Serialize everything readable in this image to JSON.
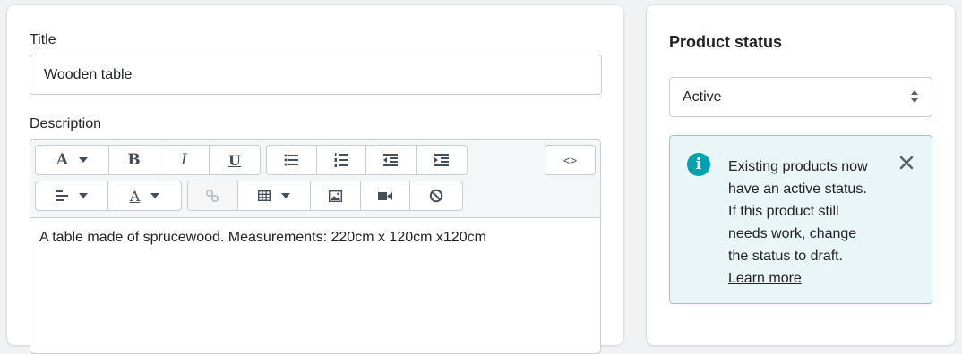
{
  "product": {
    "title_label": "Title",
    "title_value": "Wooden table",
    "description_label": "Description",
    "description_value": "A table made of sprucewood. Measurements: 220cm x 120cm x120cm"
  },
  "toolbar": {
    "font_label": "A",
    "bold_label": "B",
    "italic_label": "I",
    "underline_label": "U",
    "html_label": "<>",
    "text_color_label": "A"
  },
  "status": {
    "heading": "Product status",
    "selected": "Active",
    "banner_lines": [
      "Existing products now",
      "have an active status.",
      "If this product still",
      "needs work, change",
      "the status to draft."
    ],
    "learn_more": "Learn more",
    "info_glyph": "i"
  },
  "colors": {
    "info_icon": "#00a0ac",
    "banner_bg": "#eaf5f8",
    "banner_border": "#98c6cd"
  }
}
